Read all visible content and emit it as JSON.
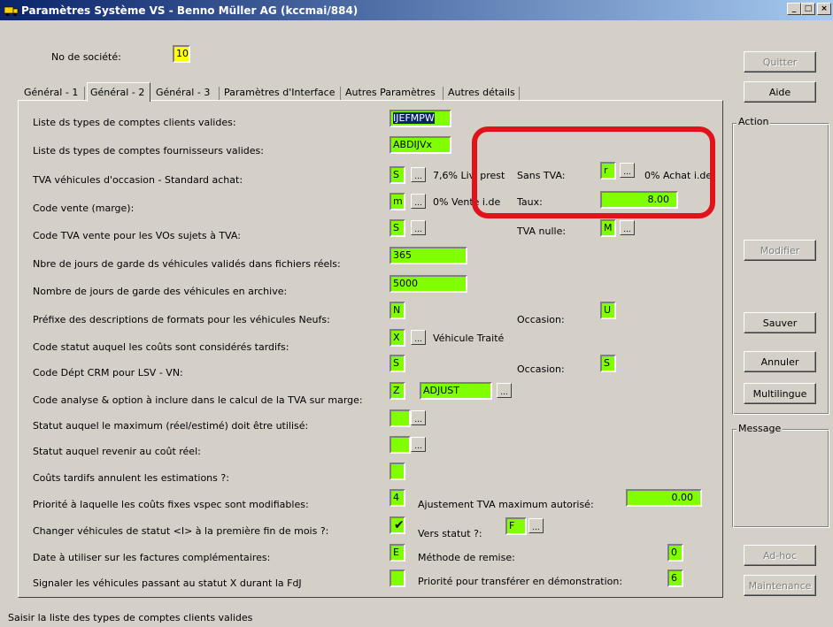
{
  "window": {
    "title": "Paramètres Système VS - Benno Müller AG (kccmai/884)",
    "controls": [
      "_",
      "□",
      "×"
    ]
  },
  "company": {
    "label": "No de société:",
    "value": "10"
  },
  "tabs": [
    "Général - 1",
    "Général - 2",
    "Général - 3",
    "Paramètres d'Interface",
    "Autres Paramètres",
    "Autres détails"
  ],
  "active_tab": "Général - 2",
  "rows": {
    "clients": {
      "label": "Liste ds types de comptes clients valides:",
      "value": "IJEFMPW"
    },
    "fournisseurs": {
      "label": "Liste ds types de comptes fournisseurs valides:",
      "value": "ABDIJVx"
    },
    "tva_occasion": {
      "label": "TVA véhicules d'occasion - Standard achat:",
      "value": "S",
      "desc": "7,6% Liv. prest",
      "sans_tva_label": "Sans TVA:",
      "sans_tva_value": "r",
      "sans_tva_desc": "0% Achat i.de"
    },
    "code_vente": {
      "label": "Code vente (marge):",
      "value": "m",
      "desc": "0% Vente i.de",
      "taux_label": "Taux:",
      "taux_value": "8.00"
    },
    "code_tva_vente": {
      "label": "Code TVA vente pour les VOs sujets à TVA:",
      "value": "S",
      "tva_nulle_label": "TVA nulle:",
      "tva_nulle_value": "M"
    },
    "jours_reels": {
      "label": "Nbre de jours de garde ds véhicules validés dans fichiers réels:",
      "value": "365"
    },
    "jours_archive": {
      "label": "Nombre de jours de garde des véhicules en archive:",
      "value": "5000"
    },
    "prefixe": {
      "label": "Préfixe des descriptions de formats pour les véhicules Neufs:",
      "value": "N",
      "occasion_label": "Occasion:",
      "occasion_value": "U"
    },
    "code_statut": {
      "label": "Code statut auquel les coûts sont considérés tardifs:",
      "value": "X",
      "desc": "Véhicule Traité"
    },
    "code_dept": {
      "label": "Code Dépt CRM pour LSV - VN:",
      "value": "S",
      "occasion_label": "Occasion:",
      "occasion_value": "S"
    },
    "code_analyse": {
      "label": "Code analyse & option à inclure dans le calcul de la TVA sur marge:",
      "value": "Z",
      "value2": "ADJUST"
    },
    "statut_max": {
      "label": "Statut auquel le maximum (réel/estimé) doit être utilisé:",
      "value": ""
    },
    "statut_revenir": {
      "label": "Statut auquel revenir au coût réel:",
      "value": ""
    },
    "couts_tardifs": {
      "label": "Coûts tardifs annulent les estimations ?:",
      "value": ""
    },
    "priorite_couts": {
      "label": "Priorité à laquelle les coûts fixes vspec sont modifiables:",
      "value": "4",
      "ajust_label": "Ajustement TVA maximum autorisé:",
      "ajust_value": "0.00"
    },
    "changer_statut": {
      "label": "Changer véhicules de statut <I> à la première fin de mois ?:",
      "checked": true,
      "vers_label": "Vers statut ?:",
      "vers_value": "F"
    },
    "date_factures": {
      "label": "Date à utiliser sur les factures complémentaires:",
      "value": "E",
      "methode_label": "Méthode de remise:",
      "methode_value": "0"
    },
    "signaler": {
      "label": "Signaler les véhicules passant au statut X durant la FdJ",
      "value": "",
      "priorite_label": "Priorité pour transférer en démonstration:",
      "priorite_value": "6"
    }
  },
  "buttons": {
    "quitter": "Quitter",
    "aide": "Aide",
    "modifier": "Modifier",
    "sauver": "Sauver",
    "annuler": "Annuler",
    "multilingue": "Multilingue",
    "adhoc": "Ad-hoc",
    "maintenance": "Maintenance"
  },
  "groups": {
    "action": "Action",
    "message": "Message"
  },
  "status": "Saisir la liste des types de comptes clients valides",
  "colors": {
    "field_green": "#80ff00",
    "field_yellow": "#ffff00",
    "highlight_red": "#e0131a",
    "titlebar": "#0a246a"
  }
}
